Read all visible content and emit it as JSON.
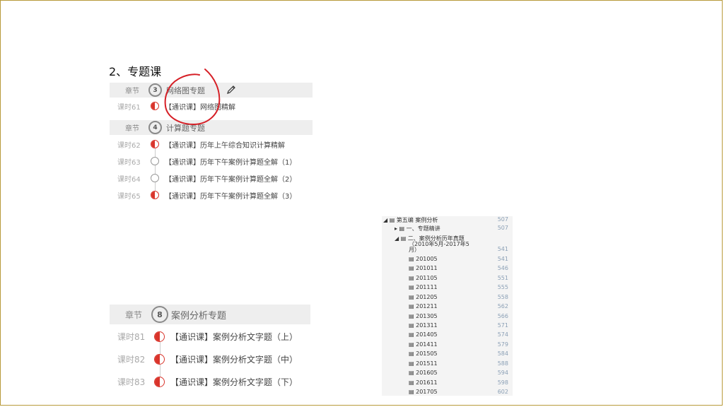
{
  "heading": "2、专题课",
  "top_panel": {
    "chapters": [
      {
        "label": "章节",
        "num": "3",
        "title": "网络图专题",
        "lessons": [
          {
            "no": "课时61",
            "title": "【通识课】网络图精解",
            "status": "half"
          }
        ]
      },
      {
        "label": "章节",
        "num": "4",
        "title": "计算题专题",
        "lessons": [
          {
            "no": "课时62",
            "title": "【通识课】历年上午综合知识计算精解",
            "status": "half"
          },
          {
            "no": "课时63",
            "title": "【通识课】历年下午案例计算题全解（1）",
            "status": "empty"
          },
          {
            "no": "课时64",
            "title": "【通识课】历年下午案例计算题全解（2）",
            "status": "empty"
          },
          {
            "no": "课时65",
            "title": "【通识课】历年下午案例计算题全解（3）",
            "status": "half"
          }
        ]
      }
    ]
  },
  "bottom_panel": {
    "chapter": {
      "label": "章节",
      "num": "8",
      "title": "案例分析专题"
    },
    "lessons": [
      {
        "no": "课时81",
        "title": "【通识课】案例分析文字题（上）",
        "status": "half"
      },
      {
        "no": "课时82",
        "title": "【通识课】案例分析文字题（中）",
        "status": "half"
      },
      {
        "no": "课时83",
        "title": "【通识课】案例分析文字题（下）",
        "status": "half"
      }
    ]
  },
  "toc": {
    "rows": [
      {
        "text": "◢ ▤ 第五编 案例分析",
        "page": "507",
        "indent": 2
      },
      {
        "text": "▸ ▤ 一、专题精讲",
        "page": "507",
        "indent": 18
      },
      {
        "text": "◢ ▤ 二、案例分析历年真题",
        "page": "",
        "indent": 18
      },
      {
        "text": "（2010年5月-2017年5",
        "page": "",
        "indent": 38
      },
      {
        "text": "月）",
        "page": "541",
        "indent": 38
      },
      {
        "text": "▤ 201005",
        "page": "541",
        "indent": 38
      },
      {
        "text": "▤ 201011",
        "page": "546",
        "indent": 38
      },
      {
        "text": "▤ 201105",
        "page": "551",
        "indent": 38
      },
      {
        "text": "▤ 201111",
        "page": "555",
        "indent": 38
      },
      {
        "text": "▤ 201205",
        "page": "558",
        "indent": 38
      },
      {
        "text": "▤ 201211",
        "page": "562",
        "indent": 38
      },
      {
        "text": "▤ 201305",
        "page": "566",
        "indent": 38
      },
      {
        "text": "▤ 201311",
        "page": "571",
        "indent": 38
      },
      {
        "text": "▤ 201405",
        "page": "574",
        "indent": 38
      },
      {
        "text": "▤ 201411",
        "page": "579",
        "indent": 38
      },
      {
        "text": "▤ 201505",
        "page": "584",
        "indent": 38
      },
      {
        "text": "▤ 201511",
        "page": "588",
        "indent": 38
      },
      {
        "text": "▤ 201605",
        "page": "594",
        "indent": 38
      },
      {
        "text": "▤ 201611",
        "page": "598",
        "indent": 38
      },
      {
        "text": "▤ 201705",
        "page": "602",
        "indent": 38
      }
    ]
  },
  "colors": {
    "frame": "#b89a3a",
    "annotation": "#d61f26",
    "progress": "#d9342b"
  }
}
